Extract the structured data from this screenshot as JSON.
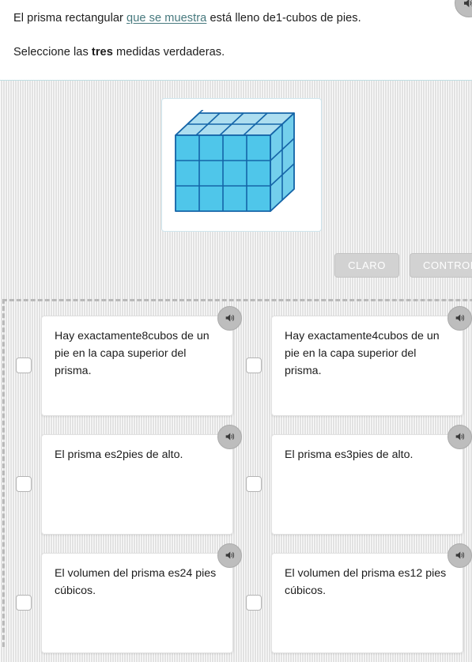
{
  "header": {
    "sentence_part1": "El prisma rectangular ",
    "link_text": "que se muestra",
    "sentence_part2": " está lleno de1-cubos de pies.",
    "instruction_part1": "Seleccione las ",
    "instruction_bold": "tres",
    "instruction_part2": " medidas verdaderas.",
    "speaker_icon": "speaker-icon"
  },
  "figure": {
    "name": "rectangular-prism-unit-cubes",
    "width_cubes": 4,
    "height_cubes": 3,
    "depth_cubes": 2,
    "front_color": "#4FC6EA",
    "top_color": "#ADDEF0",
    "side_color": "#73CFEC",
    "edge_color": "#1565A8"
  },
  "toolbar": {
    "clear_label": "CLARO",
    "check_label": "CONTROLAR"
  },
  "options": [
    {
      "id": "option-1",
      "text": "Hay exactamente8cubos de un pie en la capa superior del prisma.",
      "checked": false,
      "speaker_icon": "speaker-icon"
    },
    {
      "id": "option-2",
      "text": "Hay exactamente4cubos de un pie en la capa superior del prisma.",
      "checked": false,
      "speaker_icon": "speaker-icon"
    },
    {
      "id": "option-3",
      "text": "El prisma es2pies de alto.",
      "checked": false,
      "speaker_icon": "speaker-icon"
    },
    {
      "id": "option-4",
      "text": "El prisma es3pies de alto.",
      "checked": false,
      "speaker_icon": "speaker-icon"
    },
    {
      "id": "option-5",
      "text": "El volumen del prisma es24 pies cúbicos.",
      "checked": false,
      "speaker_icon": "speaker-icon"
    },
    {
      "id": "option-6",
      "text": "El volumen del prisma es12 pies cúbicos.",
      "checked": false,
      "speaker_icon": "speaker-icon"
    }
  ],
  "colors": {
    "background": "#ececec",
    "card_border": "#bfdfe2",
    "link": "#47797e",
    "button": "#d2d2d2",
    "dashed_border": "#b9b9b9"
  }
}
